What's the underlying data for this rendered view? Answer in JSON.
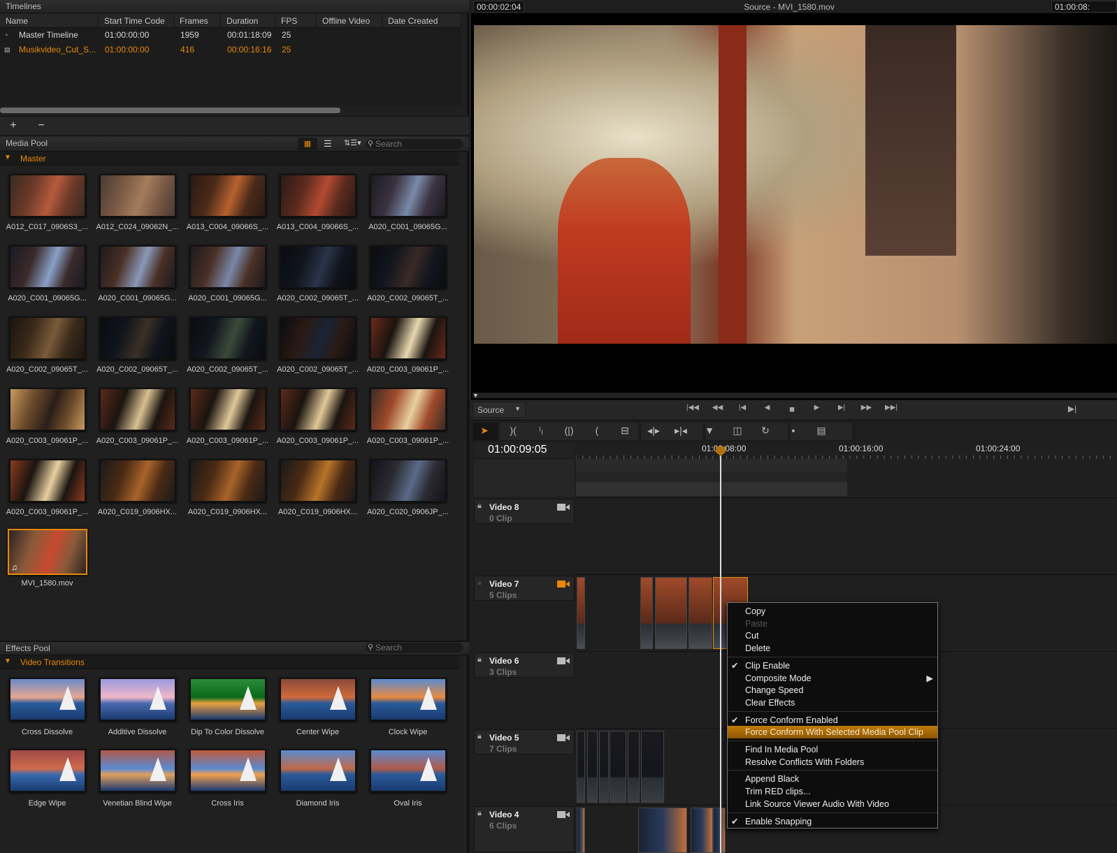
{
  "colors": {
    "accent": "#e8890c",
    "background": "#1e1e1e",
    "menu_highlight": "#b06f06"
  },
  "timelines": {
    "title": "Timelines",
    "columns": [
      "Name",
      "Start Time Code",
      "Frames",
      "Duration",
      "FPS",
      "Offline Video",
      "Date Created"
    ],
    "rows": [
      {
        "icon": "timeline-lock-icon",
        "name": "Master Timeline",
        "start": "01:00:00:00",
        "frames": "1959",
        "duration": "00:01:18:09",
        "fps": "25",
        "selected": false
      },
      {
        "icon": "xml-icon",
        "name": "Musikvideo_Cut_S...",
        "start": "01:00:00:00",
        "frames": "416",
        "duration": "00:00:16:16",
        "fps": "25",
        "selected": true
      }
    ],
    "add_label": "+",
    "remove_label": "−"
  },
  "media_pool": {
    "title": "Media Pool",
    "search_placeholder": "Search",
    "folder": "Master",
    "clips": [
      {
        "name": "A012_C017_0906S3_...",
        "tone": [
          "#6b3a28",
          "#b65a3c",
          "#3a2a22"
        ]
      },
      {
        "name": "A012_C024_09062N_...",
        "tone": [
          "#7a5a46",
          "#a57c5c",
          "#4a3a30"
        ]
      },
      {
        "name": "A013_C004_09066S_...",
        "tone": [
          "#4a2a1a",
          "#b8622e",
          "#2a1a12"
        ]
      },
      {
        "name": "A013_C004_09066S_...",
        "tone": [
          "#5a2a1e",
          "#b34a32",
          "#2a1a16"
        ]
      },
      {
        "name": "A020_C001_09065G...",
        "tone": [
          "#3a3240",
          "#7a8aa8",
          "#1a1a22"
        ]
      },
      {
        "name": "A020_C001_09065G...",
        "tone": [
          "#3a2a2a",
          "#8aa0c8",
          "#1a1a22"
        ]
      },
      {
        "name": "A020_C001_09065G...",
        "tone": [
          "#4a3026",
          "#8a98b8",
          "#1c1a1e"
        ]
      },
      {
        "name": "A020_C001_09065G...",
        "tone": [
          "#4a3026",
          "#7a88a8",
          "#1c1a1e"
        ]
      },
      {
        "name": "A020_C002_09065T_...",
        "tone": [
          "#10141c",
          "#2a3448",
          "#0a0c10"
        ]
      },
      {
        "name": "A020_C002_09065T_...",
        "tone": [
          "#14161e",
          "#3a2a26",
          "#0a0c10"
        ]
      },
      {
        "name": "A020_C002_09065T_...",
        "tone": [
          "#3a2a1a",
          "#7a5a3a",
          "#1a1410"
        ]
      },
      {
        "name": "A020_C002_09065T_...",
        "tone": [
          "#10141c",
          "#3a3026",
          "#0a0c10"
        ]
      },
      {
        "name": "A020_C002_09065T_...",
        "tone": [
          "#12161e",
          "#3a4a3a",
          "#0a0c10"
        ]
      },
      {
        "name": "A020_C002_09065T_...",
        "tone": [
          "#2a1a14",
          "#1a2434",
          "#0a0c10"
        ]
      },
      {
        "name": "A020_C003_09061P_...",
        "tone": [
          "#1a1410",
          "#e8d8b0",
          "#6a2a1a"
        ]
      },
      {
        "name": "A020_C003_09061P_...",
        "tone": [
          "#6a4a2a",
          "#2a1e18",
          "#c89a60"
        ]
      },
      {
        "name": "A020_C003_09061P_...",
        "tone": [
          "#1a1410",
          "#d8c090",
          "#5a2a1a"
        ]
      },
      {
        "name": "A020_C003_09061P_...",
        "tone": [
          "#1a1410",
          "#e0c898",
          "#5a2a1a"
        ]
      },
      {
        "name": "A020_C003_09061P_...",
        "tone": [
          "#1a1410",
          "#e0c898",
          "#5a2a1a"
        ]
      },
      {
        "name": "A020_C003_09061P_...",
        "tone": [
          "#a04a2a",
          "#e8d0a0",
          "#3a2a24"
        ]
      },
      {
        "name": "A020_C003_09061P_...",
        "tone": [
          "#1a1410",
          "#e8d0a0",
          "#8a3a20"
        ]
      },
      {
        "name": "A020_C019_0906HX...",
        "tone": [
          "#4a2a14",
          "#a8642a",
          "#1a1a1a"
        ]
      },
      {
        "name": "A020_C019_0906HX...",
        "tone": [
          "#4a2a14",
          "#a8642a",
          "#1a1a1a"
        ]
      },
      {
        "name": "A020_C019_0906HX...",
        "tone": [
          "#4a2a14",
          "#b8742a",
          "#1a1a1a"
        ]
      },
      {
        "name": "A020_C020_0906JP_...",
        "tone": [
          "#2a2a30",
          "#5a6a88",
          "#121418"
        ]
      },
      {
        "name": "MVI_1580.mov",
        "tone": [
          "#8a5a3a",
          "#c84a30",
          "#2a2220"
        ],
        "selected": true,
        "audio": true
      }
    ]
  },
  "effects_pool": {
    "title": "Effects Pool",
    "search_placeholder": "Search",
    "folder": "Video Transitions",
    "items": [
      {
        "name": "Cross Dissolve",
        "tone": [
          "#6a8ac8",
          "#e8a890",
          "#2a5a9a"
        ]
      },
      {
        "name": "Additive Dissolve",
        "tone": [
          "#9a9ae0",
          "#f0b8c8",
          "#4a6ab0"
        ]
      },
      {
        "name": "Dip To Color Dissolve",
        "tone": [
          "#2a8a3a",
          "#0a6a1a",
          "#e8a040"
        ]
      },
      {
        "name": "Center Wipe",
        "tone": [
          "#8a4a3a",
          "#d06a3a",
          "#2a5a9a"
        ]
      },
      {
        "name": "Clock Wipe",
        "tone": [
          "#5a8ad0",
          "#e88a40",
          "#2a5a9a"
        ]
      },
      {
        "name": "Edge Wipe",
        "tone": [
          "#a04a4a",
          "#d06a4a",
          "#3a6ab0"
        ]
      },
      {
        "name": "Venetian Blind Wipe",
        "tone": [
          "#b05a4a",
          "#5a8ad0",
          "#e0a060"
        ]
      },
      {
        "name": "Cross Iris",
        "tone": [
          "#c05a3a",
          "#5a8ad0",
          "#f0a050"
        ]
      },
      {
        "name": "Diamond Iris",
        "tone": [
          "#5a8ad0",
          "#c06a4a",
          "#2a5a9a"
        ]
      },
      {
        "name": "Oval Iris",
        "tone": [
          "#5a8ad0",
          "#b05a4a",
          "#2a5a9a"
        ]
      }
    ]
  },
  "viewer": {
    "timecode_left": "00:00:02:04",
    "title": "Source - MVI_1580.mov",
    "timecode_right": "01:00:08:",
    "source_select": "Source"
  },
  "transport": [
    "go-to-start-icon",
    "rewind-icon",
    "previous-frame-icon",
    "step-back-icon",
    "stop-icon",
    "play-icon",
    "next-frame-icon",
    "fast-forward-icon",
    "go-to-end-icon"
  ],
  "edit_tools": [
    "selection-tool-icon",
    "trim-tool-icon",
    "razor-link-icon",
    "ripple-trim-icon",
    "roll-trim-icon",
    "blade-icon",
    "slip-icon",
    "slide-icon",
    "insert-icon",
    "overwrite-icon",
    "replace-icon",
    "append-black-icon",
    "append-clip-icon"
  ],
  "timeline": {
    "current_timecode": "01:00:09:05",
    "ruler_labels": [
      "01:00:08:00",
      "01:00:16:00",
      "01:00:24:00"
    ],
    "tracks": [
      {
        "name": "Video 8",
        "count": "0 Clip",
        "active": false
      },
      {
        "name": "Video 7",
        "count": "5 Clips",
        "active": true
      },
      {
        "name": "Video 6",
        "count": "3 Clips",
        "active": false
      },
      {
        "name": "Video 5",
        "count": "7 Clips",
        "active": false
      },
      {
        "name": "Video 4",
        "count": "6 Clips",
        "active": false
      }
    ]
  },
  "context_menu": {
    "groups": [
      [
        {
          "label": "Copy"
        },
        {
          "label": "Paste",
          "disabled": true
        },
        {
          "label": "Cut"
        },
        {
          "label": "Delete"
        }
      ],
      [
        {
          "label": "Clip Enable",
          "checked": true
        },
        {
          "label": "Composite Mode",
          "submenu": true
        },
        {
          "label": "Change Speed"
        },
        {
          "label": "Clear Effects"
        }
      ],
      [
        {
          "label": "Force Conform Enabled",
          "checked": true
        },
        {
          "label": "Force Conform With Selected Media Pool Clip",
          "highlighted": true
        }
      ],
      [
        {
          "label": "Find In Media Pool"
        },
        {
          "label": "Resolve Conflicts With Folders"
        }
      ],
      [
        {
          "label": "Append Black"
        },
        {
          "label": "Trim RED clips..."
        },
        {
          "label": "Link Source Viewer Audio With Video"
        }
      ],
      [
        {
          "label": "Enable Snapping",
          "checked": true
        }
      ]
    ]
  }
}
